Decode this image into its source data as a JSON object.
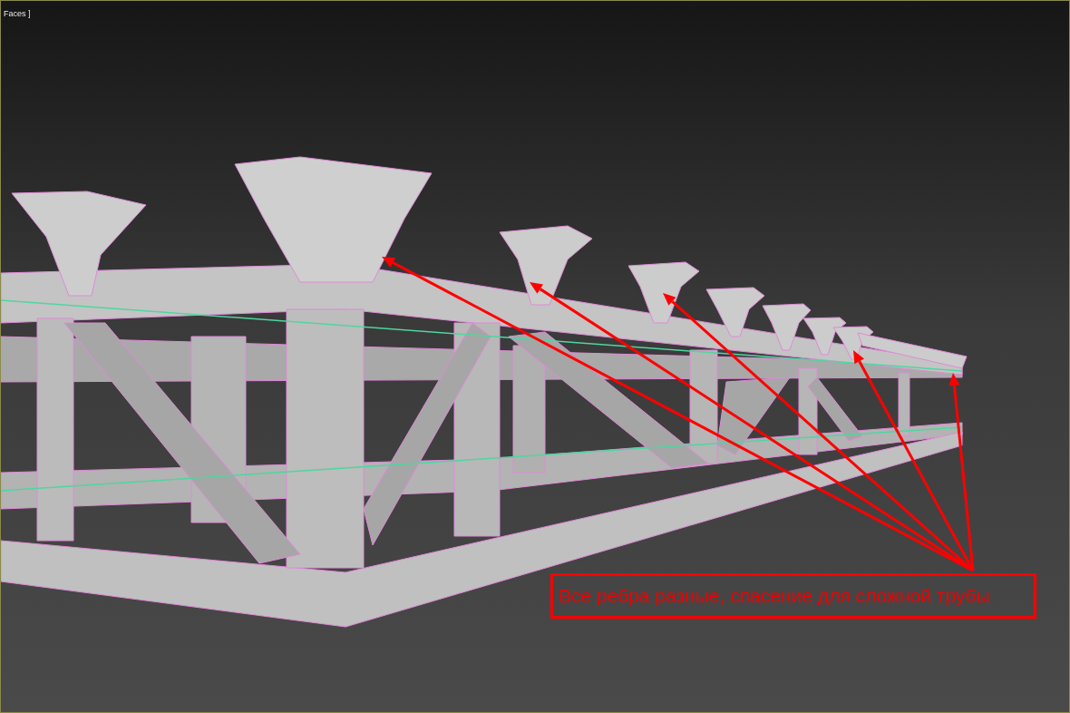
{
  "viewport": {
    "label": "Faces ]"
  },
  "callout": {
    "text": "Все ребра разные, спасение для сложной трубы"
  }
}
